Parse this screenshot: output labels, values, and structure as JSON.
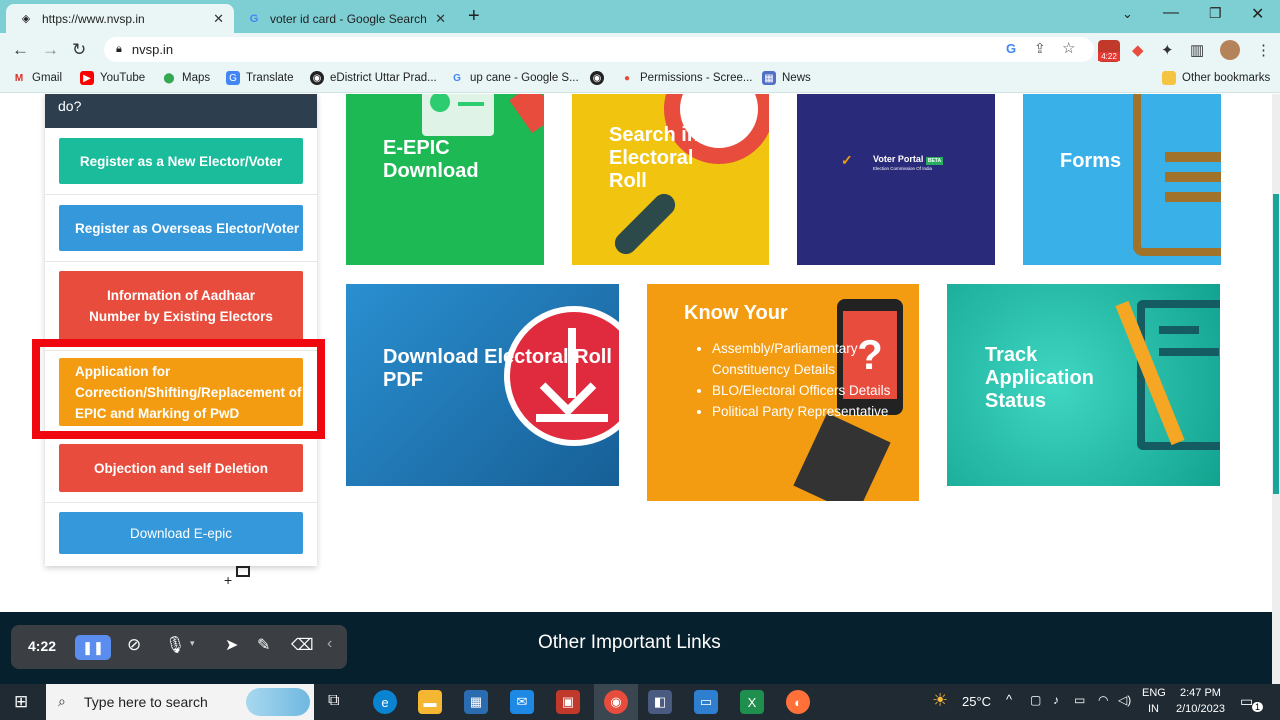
{
  "browser": {
    "tabs": [
      {
        "title": "https://www.nvsp.in",
        "active": true
      },
      {
        "title": "voter id card - Google Search",
        "active": false
      }
    ],
    "url": "nvsp.in",
    "bookmarks": [
      "Gmail",
      "YouTube",
      "Maps",
      "Translate",
      "eDistrict Uttar Prad...",
      "up cane - Google S...",
      "",
      "Permissions - Scree...",
      "News"
    ],
    "other_bookmarks": "Other bookmarks",
    "ext_badge": "4:22"
  },
  "panel": {
    "heading": "do?",
    "buttons": [
      {
        "label": "Register as a New Elector/Voter",
        "color": "#1abc9c"
      },
      {
        "label": "Register as Overseas Elector/Voter",
        "color": "#3498db"
      },
      {
        "label": "Information of Aadhaar Number by Existing Electors",
        "color": "#e74c3c"
      },
      {
        "label": "Application for Correction/Shifting/Replacement of Duplicate EPIC and Marking of PwD",
        "color": "#f39c12"
      },
      {
        "label": "Objection and self Deletion",
        "color": "#e74c3c"
      },
      {
        "label": "Download E-epic",
        "color": "#3498db"
      }
    ]
  },
  "tiles": {
    "epic": {
      "title": "E-EPIC Download",
      "color": "#1db954"
    },
    "search": {
      "title": "Search in Electoral Roll",
      "color": "#f1c40f"
    },
    "portal": {
      "title": "Voter Portal",
      "badge": "BETA",
      "subtitle": "Election Commission Of India",
      "color": "#2a2a7a"
    },
    "forms": {
      "title": "Forms",
      "color": "#3ab0e8"
    },
    "roll_pdf": {
      "title": "Download Electoral Roll PDF",
      "color": "#1f7fc0"
    },
    "know": {
      "title": "Know Your",
      "items": [
        "Assembly/Parliamentary Constituency Details",
        "BLO/Electoral Officers Details",
        "Political Party Representative"
      ],
      "color": "#f39c12"
    },
    "track": {
      "title": "Track Application Status",
      "color": "#1abc9c"
    }
  },
  "footer": {
    "title": "Other Important Links"
  },
  "recorder": {
    "time": "4:22"
  },
  "taskbar": {
    "search_placeholder": "Type here to search",
    "weather": "25°C",
    "lang_top": "ENG",
    "lang_bottom": "IN",
    "time": "2:47 PM",
    "date": "2/10/2023",
    "notif_count": "1"
  }
}
